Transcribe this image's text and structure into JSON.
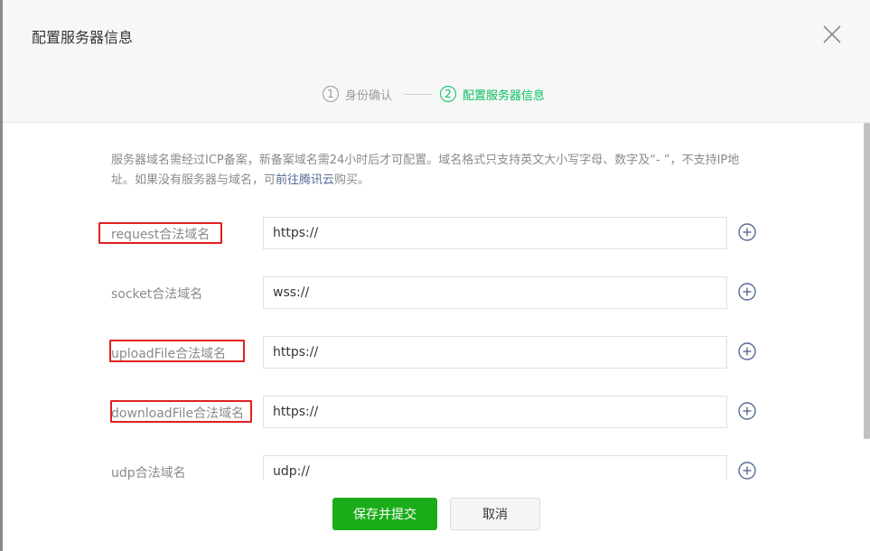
{
  "dialog": {
    "title": "配置服务器信息"
  },
  "steps": [
    {
      "num": "1",
      "label": "身份确认"
    },
    {
      "num": "2",
      "label": "配置服务器信息"
    }
  ],
  "notice": {
    "text_before": "服务器域名需经过ICP备案，新备案域名需24小时后才可配置。域名格式只支持英文大小写字母、数字及“- ”，不支持IP地址。如果没有服务器与域名，可",
    "link": "前往腾讯云",
    "text_after": "购买。"
  },
  "fields": [
    {
      "label": "request合法域名",
      "value": "https://"
    },
    {
      "label": "socket合法域名",
      "value": "wss://"
    },
    {
      "label": "uploadFile合法域名",
      "value": "https://"
    },
    {
      "label": "downloadFile合法域名",
      "value": "https://"
    },
    {
      "label": "udp合法域名",
      "value": "udp://"
    }
  ],
  "footer": {
    "save_label": "保存并提交",
    "cancel_label": "取消"
  },
  "colors": {
    "accent_green": "#07c160",
    "button_green": "#1aad19",
    "link_blue": "#576b95",
    "highlight_red": "#e02020"
  },
  "icons": {
    "close": "close-icon",
    "add": "plus-circle-icon"
  }
}
